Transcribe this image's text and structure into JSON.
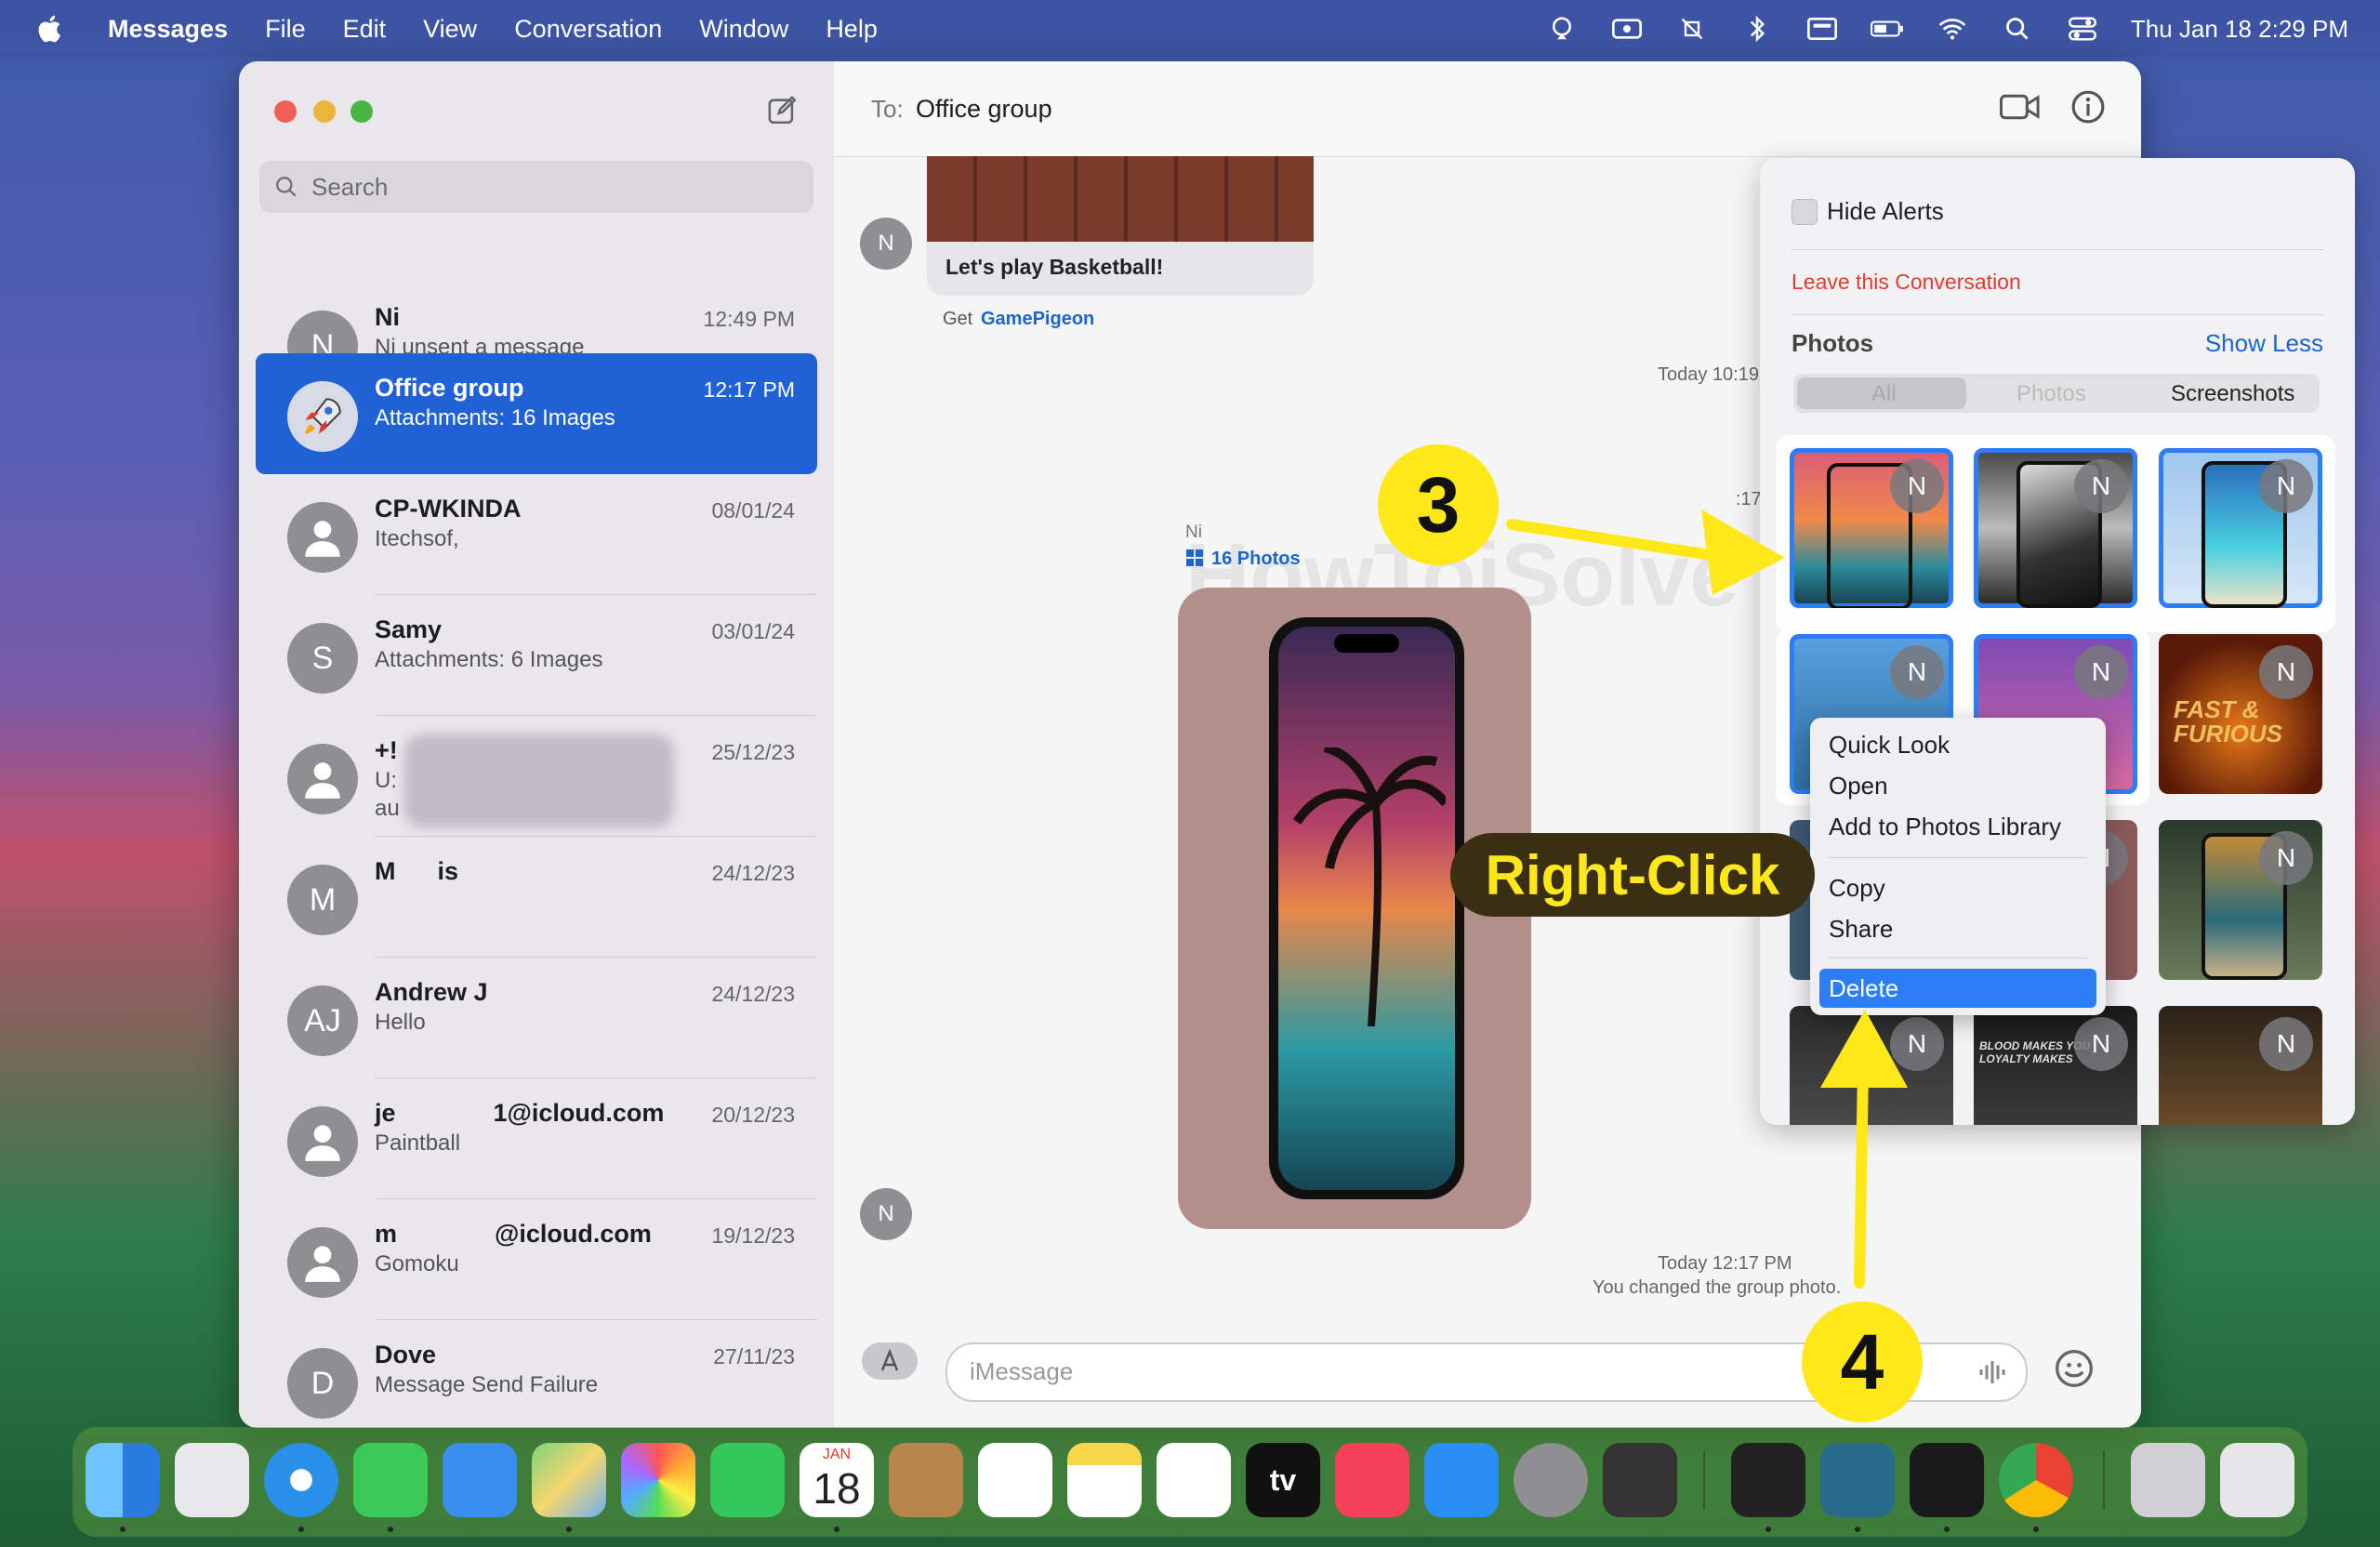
{
  "menubar": {
    "app_name": "Messages",
    "items": [
      "File",
      "Edit",
      "View",
      "Conversation",
      "Window",
      "Help"
    ],
    "datetime": "Thu Jan 18  2:29 PM"
  },
  "sidebar": {
    "search_placeholder": "Search",
    "conversations": [
      {
        "avatar": "N",
        "name": "Ni",
        "subtitle": "Ni unsent a message",
        "time": "12:49 PM"
      },
      {
        "avatar": "",
        "name": "Office group",
        "subtitle": "Attachments: 16 Images",
        "time": "12:17 PM",
        "selected": true
      },
      {
        "avatar": "",
        "name": "CP-WKINDA",
        "subtitle": "Itechsof,",
        "time": "08/01/24"
      },
      {
        "avatar": "S",
        "name": "Samy",
        "subtitle": "Attachments: 6 Images",
        "time": "03/01/24"
      },
      {
        "avatar": "",
        "name": "+!",
        "subtitle": "U:",
        "subtitle2": "au",
        "time": "25/12/23"
      },
      {
        "avatar": "M",
        "name": "M      is",
        "subtitle": "",
        "time": "24/12/23"
      },
      {
        "avatar": "AJ",
        "name": "Andrew J",
        "subtitle": "Hello",
        "time": "24/12/23"
      },
      {
        "avatar": "",
        "name": "je              1@icloud.com",
        "subtitle": "Paintball",
        "time": "20/12/23"
      },
      {
        "avatar": "",
        "name": "m              @icloud.com",
        "subtitle": "Gomoku",
        "time": "19/12/23"
      },
      {
        "avatar": "D",
        "name": "Dove",
        "subtitle": "Message Send Failure",
        "time": "27/11/23"
      }
    ]
  },
  "chat": {
    "to_label": "To:",
    "to_value": "Office group",
    "game_message": "Let's play Basketball!",
    "get_label": "Get",
    "get_link": "GamePigeon",
    "timestamp1": "Today 10:19 AM",
    "timestamp2_partial": ":17 PM",
    "sender_name": "Ni",
    "photos_count": "16 Photos",
    "avatar_letter": "N",
    "timestamp3": "Today 12:17 PM",
    "system_message": "You changed the group photo.",
    "compose_placeholder": "iMessage"
  },
  "info_panel": {
    "hide_alerts": "Hide Alerts",
    "leave": "Leave this Conversation",
    "photos_title": "Photos",
    "show_less": "Show Less",
    "segments": [
      "All",
      "Photos",
      "Screenshots"
    ],
    "thumb_badge": "N",
    "thumb_text_fast": "FAST & FURIOUS",
    "thumb_text_blood": "BLOOD MAKES YOU LOYALTY MAKES"
  },
  "context_menu": {
    "items": [
      "Quick Look",
      "Open",
      "Add to Photos Library"
    ],
    "items2": [
      "Copy",
      "Share"
    ],
    "delete": "Delete"
  },
  "dock": {
    "calendar_month": "JAN",
    "calendar_day": "18",
    "tv_label": "tv"
  },
  "annotations": {
    "step3": "3",
    "step4": "4",
    "right_click": "Right-Click"
  },
  "colors": {
    "accent": "#2d7df6",
    "selected_row": "#2062d6",
    "destructive": "#e03b2f",
    "callout_yellow": "#ffe81a"
  }
}
